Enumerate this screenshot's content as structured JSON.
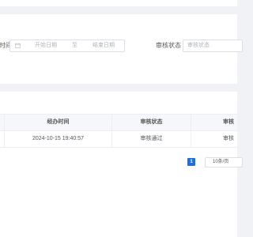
{
  "filters": {
    "time_label_partial": "时间",
    "start_placeholder": "开始日期",
    "range_separator": "至",
    "end_placeholder": "结束日期",
    "status_label": "审核状态",
    "status_placeholder": "审核状态"
  },
  "table": {
    "columns": [
      "经办时间",
      "审核状态",
      "审核"
    ],
    "rows": [
      {
        "handle_time": "2024-10-15 19:40:57",
        "status": "审核通过",
        "review_partial": "审核"
      }
    ]
  },
  "pagination": {
    "current_page": "1",
    "page_size": "10条/页"
  },
  "colors": {
    "accent": "#1e6fd9",
    "background": "#f0f2f5"
  }
}
